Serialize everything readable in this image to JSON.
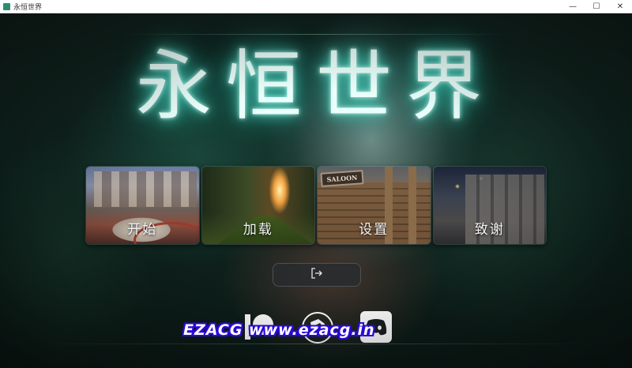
{
  "window": {
    "title": "永恒世界",
    "controls": {
      "minimize": "—",
      "maximize": "☐",
      "close": "✕"
    }
  },
  "game": {
    "title": "永恒世界"
  },
  "menu": {
    "items": [
      {
        "label": "开始"
      },
      {
        "label": "加载"
      },
      {
        "label": "设置",
        "sign": "SALOON"
      },
      {
        "label": "致谢"
      }
    ]
  },
  "exit": {
    "icon": "exit-icon"
  },
  "social": [
    {
      "icon": "patreon-icon"
    },
    {
      "icon": "round-logo-icon"
    },
    {
      "icon": "discord-icon"
    }
  ],
  "watermark": {
    "text": "EZACG  www.ezacg.in"
  },
  "colors": {
    "title_glow": "#58e0cc",
    "watermark_outline": "#2a0ad6",
    "button_bg": "#282c2e"
  }
}
